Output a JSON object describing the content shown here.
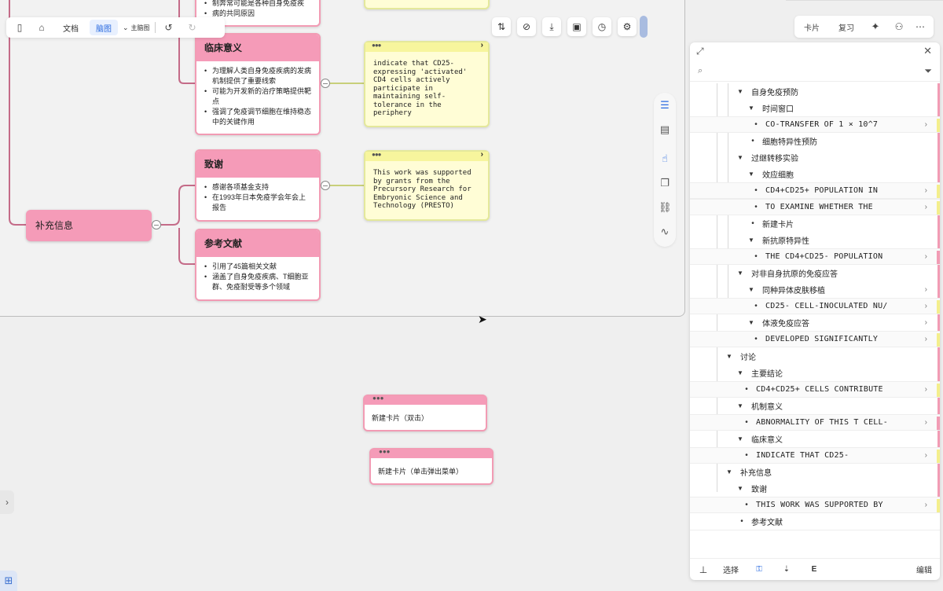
{
  "toolbar": {
    "doc_label": "文档",
    "mindmap_label": "脑图",
    "main_mindmap_label": "主脑图"
  },
  "root": {
    "label": "补充信息"
  },
  "nodes": {
    "partial_top": {
      "lines": [
        "制奔常可能是各种自身免疫疾",
        "病的共同原因"
      ]
    },
    "clinical": {
      "title": "临床意义",
      "items": [
        "为理解人类自身免疫疾病的发病机制提供了重要线索",
        "可能为开发新的治疗策略提供靶点",
        "强调了免疫调节细胞在维持稳态中的关键作用"
      ]
    },
    "thanks": {
      "title": "致谢",
      "items": [
        "感谢各项基金支持",
        "在1993年日本免疫学会年会上报告"
      ]
    },
    "refs": {
      "title": "参考文献",
      "items": [
        "引用了45篇相关文献",
        "涵盖了自身免疫疾病、T细胞亚群、免疫耐受等多个领域"
      ]
    }
  },
  "yellow_cards": {
    "clinical": "indicate that CD25-\nexpressing 'activated'\nCD4 cells actively\nparticipate in\nmaintaining self-\ntolerance in the\nperiphery",
    "thanks": "This work was supported\nby grants from the\nPrecursory Research for\nEmbryonic Science and\nTechnology (PRESTO)"
  },
  "new_cards": {
    "double_click": "新建卡片（双击）",
    "single_click": "新建卡片（单击弹出菜单）"
  },
  "right_header": {
    "card_label": "卡片",
    "review_label": "复习"
  },
  "tree": [
    {
      "label": "自身免疫预防",
      "kind": "branch"
    },
    {
      "label": "时间窗口",
      "kind": "branch"
    },
    {
      "label": "CO-TRANSFER OF 1 × 10^7",
      "kind": "card"
    },
    {
      "label": "细胞特异性预防",
      "kind": "leaf"
    },
    {
      "label": "过继转移实验",
      "kind": "branch"
    },
    {
      "label": "效应细胞",
      "kind": "branch"
    },
    {
      "label": "CD4+CD25+ POPULATION IN",
      "kind": "card"
    },
    {
      "label": "TO EXAMINE  WHETHER THE",
      "kind": "card"
    },
    {
      "label": "新建卡片",
      "kind": "leaf"
    },
    {
      "label": "新抗原特异性",
      "kind": "branch"
    },
    {
      "label": "THE CD4+CD25- POPULATION",
      "kind": "card"
    },
    {
      "label": "对非自身抗原的免疫应答",
      "kind": "branch"
    },
    {
      "label": "同种异体皮肤移植",
      "kind": "branch"
    },
    {
      "label": "CD25- CELL-INOCULATED NU/",
      "kind": "card"
    },
    {
      "label": "体液免疫应答",
      "kind": "branch"
    },
    {
      "label": "DEVELOPED SIGNIFICANTLY",
      "kind": "card"
    },
    {
      "label": "讨论",
      "kind": "branch"
    },
    {
      "label": "主要结论",
      "kind": "branch"
    },
    {
      "label": "CD4+CD25+ CELLS CONTRIBUTE",
      "kind": "card"
    },
    {
      "label": "机制意义",
      "kind": "branch"
    },
    {
      "label": "ABNORMALITY OF THIS T CELL-",
      "kind": "card"
    },
    {
      "label": "临床意义",
      "kind": "branch"
    },
    {
      "label": "INDICATE THAT CD25-",
      "kind": "card"
    },
    {
      "label": "补充信息",
      "kind": "branch"
    },
    {
      "label": "致谢",
      "kind": "branch"
    },
    {
      "label": "THIS WORK WAS SUPPORTED BY",
      "kind": "card"
    },
    {
      "label": "参考文献",
      "kind": "leaf"
    },
    {
      "label": "新建卡片（双击）",
      "kind": "root-leaf"
    },
    {
      "label": "新建卡片（单击弹出菜单）",
      "kind": "root-leaf"
    }
  ],
  "right_footer": {
    "select_label": "选择",
    "edit_label": "编辑"
  },
  "colors": {
    "pink": "#f59bb8",
    "yellow": "#fffdd6",
    "accent": "#2b6be0"
  }
}
